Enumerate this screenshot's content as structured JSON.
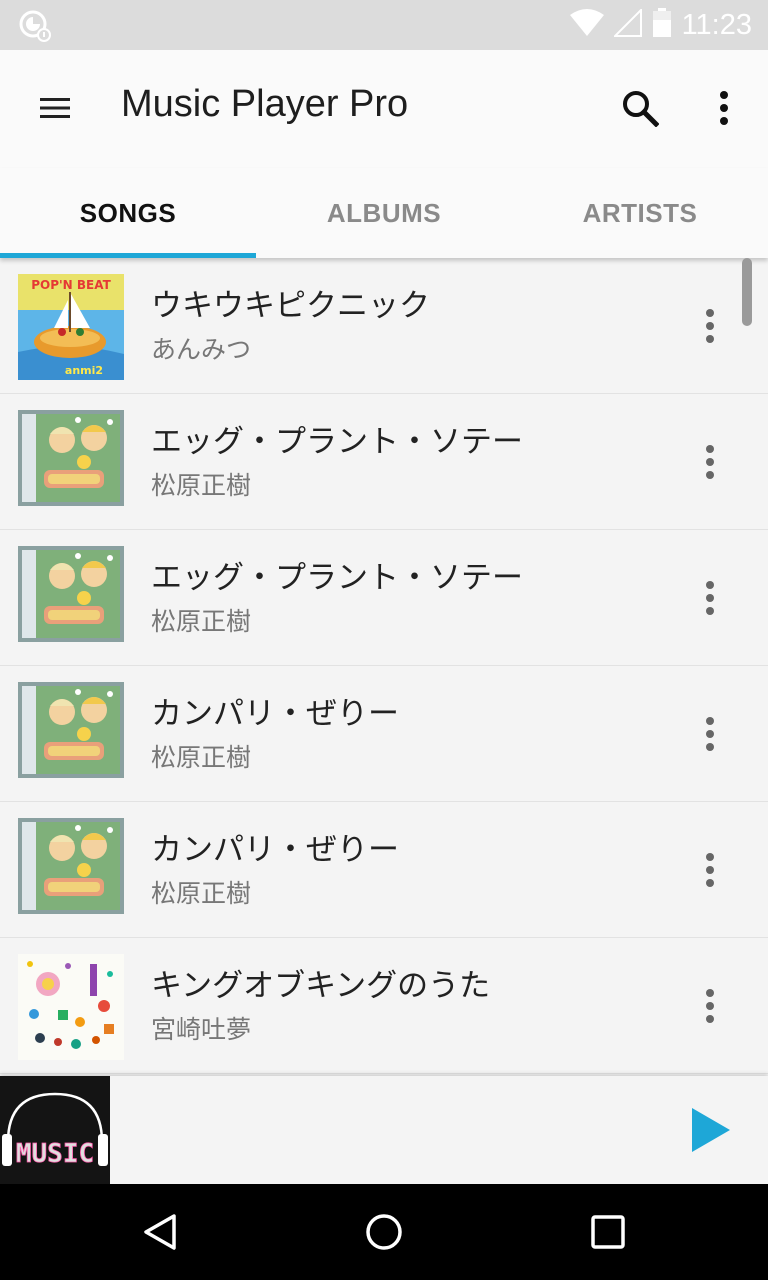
{
  "status_bar": {
    "time": "11:23",
    "icons": [
      "app-notification-icon",
      "wifi-icon",
      "cell-signal-icon",
      "battery-icon"
    ],
    "text_color": "#ffffff",
    "background": "#dcdcdc"
  },
  "app_bar": {
    "title": "Music Player Pro",
    "icons": [
      "menu-icon",
      "search-icon",
      "overflow-menu-icon"
    ]
  },
  "tabs": [
    {
      "label": "SONGS",
      "active": true
    },
    {
      "label": "ALBUMS",
      "active": false
    },
    {
      "label": "ARTISTS",
      "active": false
    }
  ],
  "accent_color": "#1ea7d7",
  "songs": [
    {
      "title": "ウキウキピクニック",
      "artist": "あんみつ",
      "art": "pop-n-beat-album-art",
      "art_text": "POP'N BEAT"
    },
    {
      "title": "エッグ・プラント・ソテー",
      "artist": "松原正樹",
      "art": "matsubara-album-art"
    },
    {
      "title": "エッグ・プラント・ソテー",
      "artist": "松原正樹",
      "art": "matsubara-album-art"
    },
    {
      "title": "カンパリ・ぜりー",
      "artist": "松原正樹",
      "art": "matsubara-album-art"
    },
    {
      "title": "カンパリ・ぜりー",
      "artist": "松原正樹",
      "art": "matsubara-album-art"
    },
    {
      "title": "キングオブキングのうた",
      "artist": "宮崎吐夢",
      "art": "miyazaki-album-art"
    }
  ],
  "mini_player": {
    "art": "music-headphones-logo",
    "art_text": "MUSIC",
    "action": "play-icon"
  },
  "nav_bar": {
    "icons": [
      "back-icon",
      "home-icon",
      "recents-icon"
    ]
  }
}
